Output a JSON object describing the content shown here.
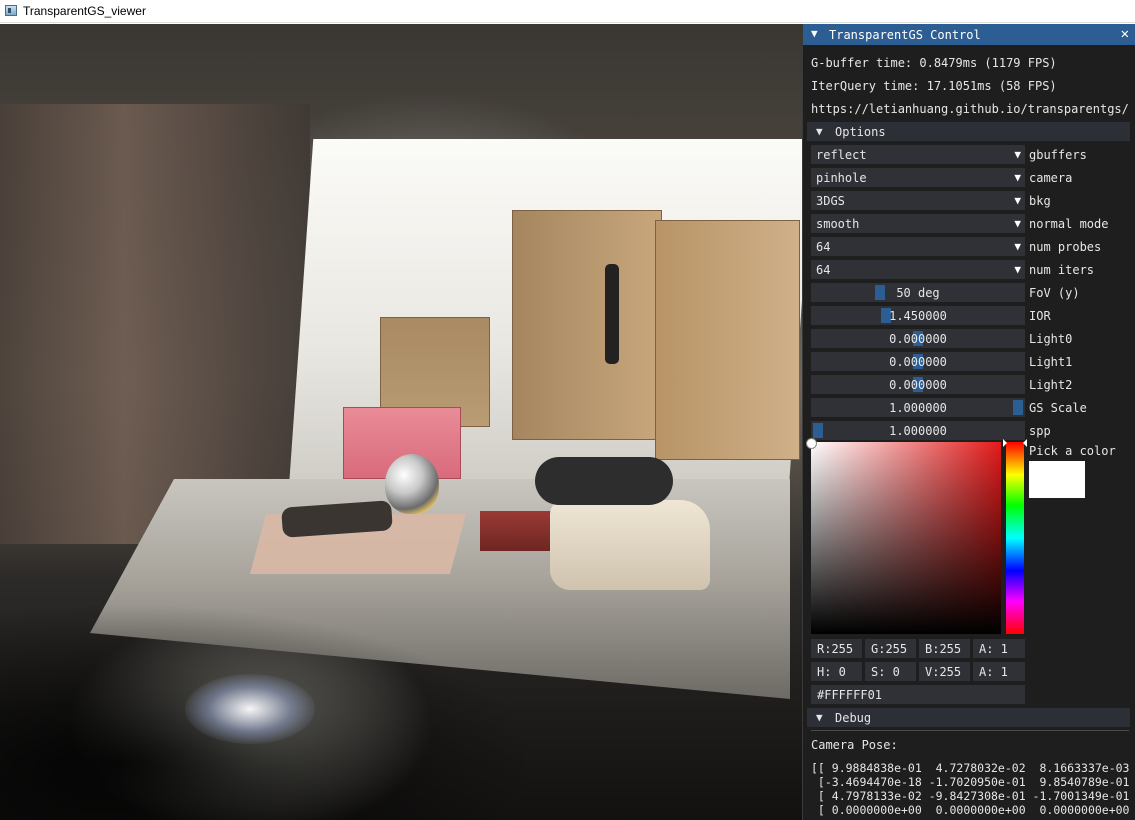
{
  "window": {
    "title": "TransparentGS_viewer"
  },
  "panel": {
    "title": "TransparentGS Control",
    "gbuffer_time": "G-buffer time:  0.8479ms (1179 FPS)",
    "iterquery_time": "IterQuery time:  17.1051ms (58 FPS)",
    "url": "https://letianhuang.github.io/transparentgs/",
    "options_header": "Options",
    "combos": [
      {
        "value": "reflect",
        "label": "gbuffers"
      },
      {
        "value": "pinhole",
        "label": "camera"
      },
      {
        "value": "3DGS",
        "label": "bkg"
      },
      {
        "value": "smooth",
        "label": "normal mode"
      },
      {
        "value": "64",
        "label": "num probes"
      },
      {
        "value": "64",
        "label": "num iters"
      }
    ],
    "sliders": [
      {
        "value": "50 deg",
        "label": "FoV (y)",
        "fraction": 0.31
      },
      {
        "value": "1.450000",
        "label": "IOR",
        "fraction": 0.34
      },
      {
        "value": "0.000000",
        "label": "Light0",
        "fraction": 0.5
      },
      {
        "value": "0.000000",
        "label": "Light1",
        "fraction": 0.5
      },
      {
        "value": "0.000000",
        "label": "Light2",
        "fraction": 0.5
      },
      {
        "value": "1.000000",
        "label": "GS Scale",
        "fraction": 1.0
      },
      {
        "value": "1.000000",
        "label": "spp",
        "fraction": 0.0
      }
    ],
    "color_picker": {
      "label": "Pick a color",
      "color": "#FFFFFF",
      "rgba": [
        "R:255",
        "G:255",
        "B:255",
        "A:  1"
      ],
      "hsva": [
        "H:  0",
        "S:  0",
        "V:255",
        "A:  1"
      ],
      "hex": "#FFFFFF01"
    },
    "debug_header": "Debug",
    "camera_pose_label": "Camera Pose:",
    "camera_pose_rows": [
      "[[ 9.9884838e-01  4.7278032e-02  8.1663337e-03",
      " [-3.4694470e-18 -1.7020950e-01  9.8540789e-01",
      " [ 4.7978133e-02 -9.8427308e-01 -1.7001349e-01",
      " [ 0.0000000e+00  0.0000000e+00  0.0000000e+00"
    ],
    "accent_color": "#2d5e93",
    "icons": {
      "collapse": "triangle-down-icon",
      "close": "close-icon",
      "dropdown": "dropdown-arrow-icon"
    }
  }
}
